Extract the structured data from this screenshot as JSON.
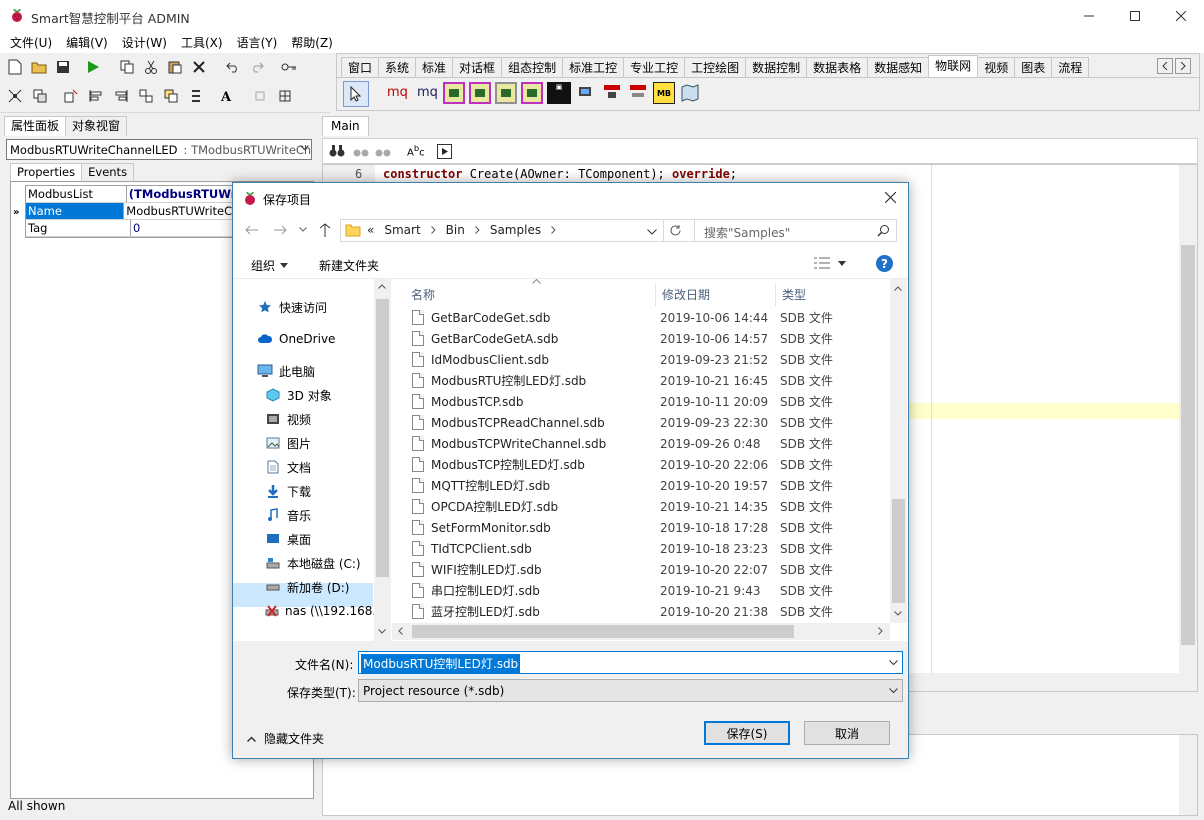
{
  "app": {
    "title": "Smart智慧控制平台 ADMIN",
    "menu": [
      "文件(U)",
      "编辑(V)",
      "设计(W)",
      "工具(X)",
      "语言(Y)",
      "帮助(Z)"
    ]
  },
  "palette": {
    "tabs": [
      "窗口",
      "系统",
      "标准",
      "对话框",
      "组态控制",
      "标准工控",
      "专业工控",
      "工控绘图",
      "数据控制",
      "数据表格",
      "数据感知",
      "物联网",
      "视频",
      "图表",
      "流程"
    ],
    "active_tab": "物联网",
    "items": [
      "mq",
      "mq"
    ]
  },
  "inspector": {
    "tabs": [
      "属性面板",
      "对象视窗"
    ],
    "selected_object": "ModbusRTUWriteChannelLED",
    "selected_class": ": TModbusRTUWriteChanr",
    "subtabs": [
      "Properties",
      "Events"
    ],
    "rows": [
      {
        "name": "ModbusList",
        "value": "(TModbusRTUWr"
      },
      {
        "name": "Name",
        "value": "ModbusRTUWriteCh"
      },
      {
        "name": "Tag",
        "value": "0"
      }
    ],
    "status": "All shown"
  },
  "editor": {
    "tab": "Main",
    "line_number": "6",
    "code": {
      "kw1": "constructor",
      "mid": " Create(AOwner: TComponent); ",
      "kw2": "override",
      "end": ";"
    }
  },
  "dialog": {
    "title": "保存项目",
    "breadcrumb": [
      "«",
      "Smart",
      "Bin",
      "Samples"
    ],
    "search_placeholder": "搜索\"Samples\"",
    "organize": "组织",
    "new_folder": "新建文件夹",
    "columns": {
      "name": "名称",
      "date": "修改日期",
      "type": "类型"
    },
    "nav": [
      {
        "label": "快速访问",
        "icon": "star-icon"
      },
      {
        "label": "OneDrive",
        "icon": "cloud-icon"
      },
      {
        "label": "此电脑",
        "icon": "computer-icon"
      },
      {
        "label": "3D 对象",
        "icon": "cube-icon"
      },
      {
        "label": "视频",
        "icon": "video-icon"
      },
      {
        "label": "图片",
        "icon": "picture-icon"
      },
      {
        "label": "文档",
        "icon": "document-icon"
      },
      {
        "label": "下载",
        "icon": "download-icon"
      },
      {
        "label": "音乐",
        "icon": "music-icon"
      },
      {
        "label": "桌面",
        "icon": "desktop-icon"
      },
      {
        "label": "本地磁盘 (C:)",
        "icon": "drive-c-icon"
      },
      {
        "label": "新加卷 (D:)",
        "icon": "drive-icon"
      },
      {
        "label": "nas (\\\\192.168.",
        "icon": "network-drive-icon"
      }
    ],
    "selected_nav": "新加卷 (D:)",
    "files": [
      {
        "name": "GetBarCodeGet.sdb",
        "date": "2019-10-06 14:44",
        "type": "SDB 文件"
      },
      {
        "name": "GetBarCodeGetA.sdb",
        "date": "2019-10-06 14:57",
        "type": "SDB 文件"
      },
      {
        "name": "IdModbusClient.sdb",
        "date": "2019-09-23 21:52",
        "type": "SDB 文件"
      },
      {
        "name": "ModbusRTU控制LED灯.sdb",
        "date": "2019-10-21 16:45",
        "type": "SDB 文件"
      },
      {
        "name": "ModbusTCP.sdb",
        "date": "2019-10-11 20:09",
        "type": "SDB 文件"
      },
      {
        "name": "ModbusTCPReadChannel.sdb",
        "date": "2019-09-23 22:30",
        "type": "SDB 文件"
      },
      {
        "name": "ModbusTCPWriteChannel.sdb",
        "date": "2019-09-26 0:48",
        "type": "SDB 文件"
      },
      {
        "name": "ModbusTCP控制LED灯.sdb",
        "date": "2019-10-20 22:06",
        "type": "SDB 文件"
      },
      {
        "name": "MQTT控制LED灯.sdb",
        "date": "2019-10-20 19:57",
        "type": "SDB 文件"
      },
      {
        "name": "OPCDA控制LED灯.sdb",
        "date": "2019-10-21 14:35",
        "type": "SDB 文件"
      },
      {
        "name": "SetFormMonitor.sdb",
        "date": "2019-10-18 17:28",
        "type": "SDB 文件"
      },
      {
        "name": "TIdTCPClient.sdb",
        "date": "2019-10-18 23:23",
        "type": "SDB 文件"
      },
      {
        "name": "WIFI控制LED灯.sdb",
        "date": "2019-10-20 22:07",
        "type": "SDB 文件"
      },
      {
        "name": "串口控制LED灯.sdb",
        "date": "2019-10-21 9:43",
        "type": "SDB 文件"
      },
      {
        "name": "蓝牙控制LED灯.sdb",
        "date": "2019-10-20 21:38",
        "type": "SDB 文件"
      }
    ],
    "filename_label": "文件名(N):",
    "filename_value": "ModbusRTU控制LED灯.sdb",
    "filetype_label": "保存类型(T):",
    "filetype_value": "Project resource (*.sdb)",
    "hide_folders": "隐藏文件夹",
    "save_button": "保存(S)",
    "cancel_button": "取消"
  },
  "colors": {
    "accent": "#0078d7",
    "selection": "#0078d7",
    "keyword": "#800000",
    "highlight_line": "#ffffcc"
  }
}
